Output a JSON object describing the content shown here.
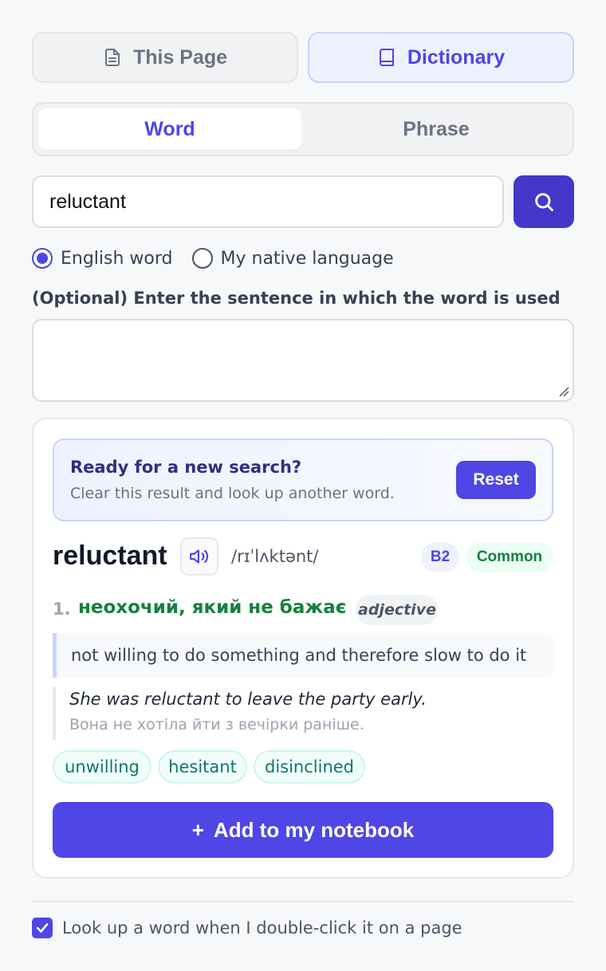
{
  "mode_tabs": [
    {
      "label": "This Page",
      "icon": "document-icon",
      "active": false
    },
    {
      "label": "Dictionary",
      "icon": "book-icon",
      "active": true
    }
  ],
  "segment": {
    "word_label": "Word",
    "phrase_label": "Phrase",
    "active": "Word"
  },
  "search": {
    "value": "reluctant",
    "button_icon": "search-icon"
  },
  "language_options": [
    {
      "label": "English word",
      "checked": true
    },
    {
      "label": "My native language",
      "checked": false
    }
  ],
  "sentence": {
    "label": "(Optional) Enter the sentence in which the word is used",
    "value": ""
  },
  "banner": {
    "title": "Ready for a new search?",
    "subtitle": "Clear this result and look up another word.",
    "reset_label": "Reset"
  },
  "entry": {
    "headword": "reluctant",
    "ipa": "/rɪˈlʌktənt/",
    "level": "B2",
    "frequency": "Common",
    "senses": [
      {
        "number": "1.",
        "translation": "неохочий, який не бажає",
        "pos": "adjective",
        "definition": "not willing to do something and therefore slow to do it",
        "example_en": "She was reluctant to leave the party early.",
        "example_tr": "Вона не хотіла йти з вечірки раніше.",
        "synonyms": [
          "unwilling",
          "hesitant",
          "disinclined"
        ]
      }
    ]
  },
  "add_button": {
    "icon": "+",
    "label": "Add to my notebook"
  },
  "footer": {
    "double_click_label": "Look up a word when I double-click it on a page",
    "checked": true
  },
  "colors": {
    "accent": "#4f46e5",
    "translation": "#15803d",
    "synonym": "#0f766e"
  }
}
